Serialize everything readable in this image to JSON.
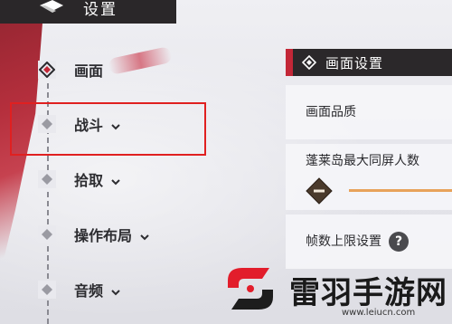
{
  "header": {
    "title": "设置"
  },
  "sidebar": {
    "items": [
      {
        "label": "画面",
        "has_chevron": false,
        "active": true
      },
      {
        "label": "战斗",
        "has_chevron": true,
        "active": false
      },
      {
        "label": "拾取",
        "has_chevron": true,
        "active": false
      },
      {
        "label": "操作布局",
        "has_chevron": true,
        "active": false
      },
      {
        "label": "音频",
        "has_chevron": true,
        "active": false
      }
    ]
  },
  "panel": {
    "title": "画面设置",
    "rows": [
      {
        "label": "画面品质"
      },
      {
        "label": "蓬莱岛最大同屏人数"
      },
      {
        "label": "帧数上限设置",
        "help": "?"
      }
    ]
  },
  "watermark": {
    "text": "雷羽手游网",
    "url": "www.leiucn.com"
  },
  "colors": {
    "accent_red": "#c32737",
    "slider": "#e8a25a",
    "header_bg": "#2b282a"
  }
}
